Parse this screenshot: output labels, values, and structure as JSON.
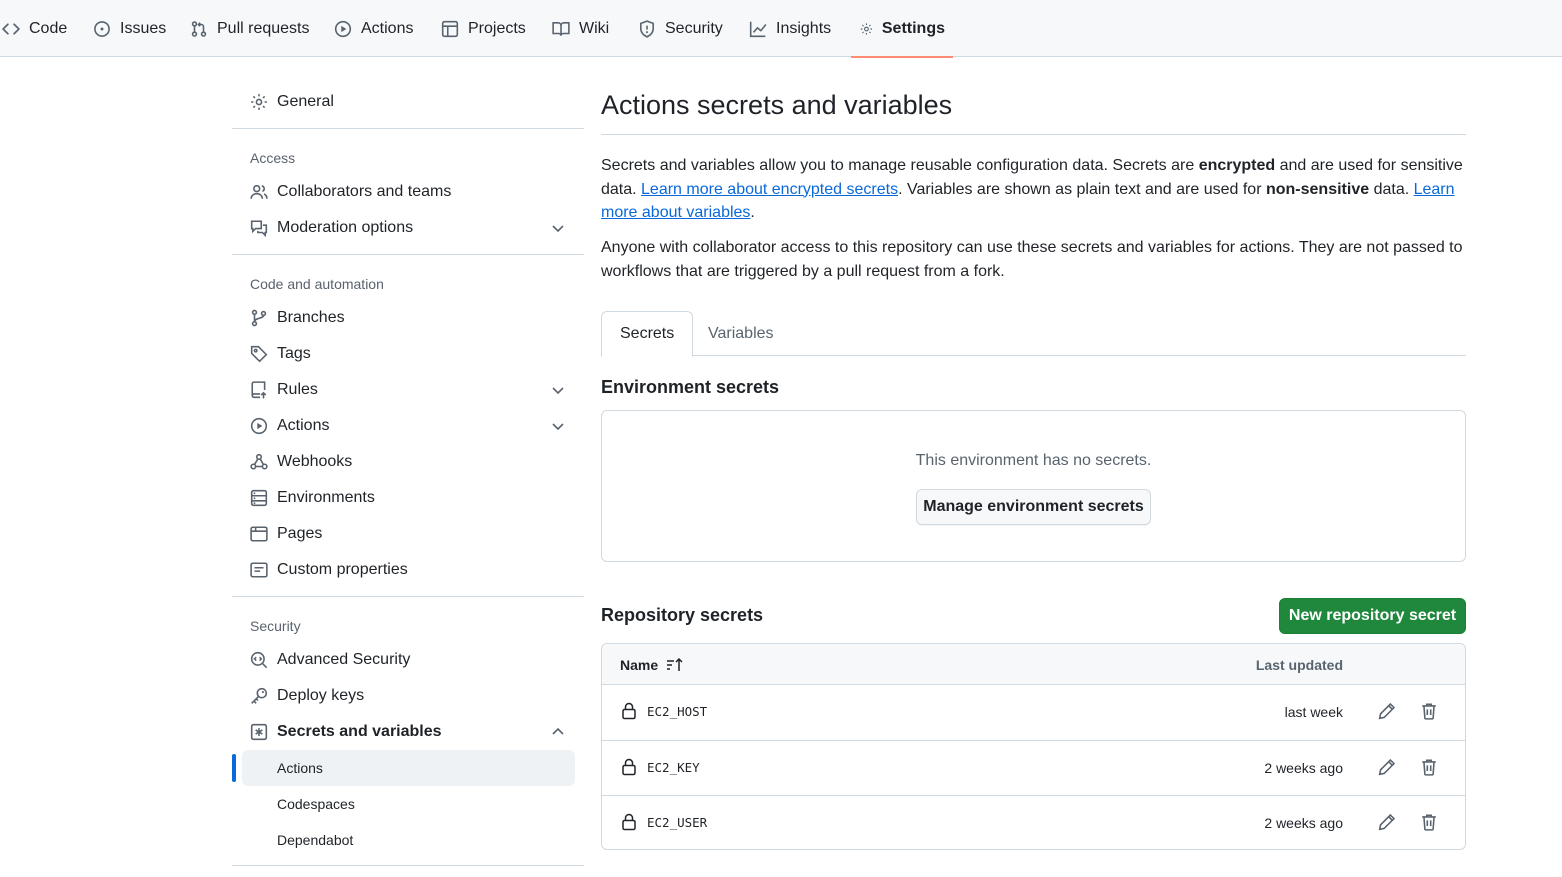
{
  "repo_nav": {
    "tabs": [
      {
        "label": "Code",
        "icon": "code-icon"
      },
      {
        "label": "Issues",
        "icon": "issue-icon"
      },
      {
        "label": "Pull requests",
        "icon": "pull-request-icon"
      },
      {
        "label": "Actions",
        "icon": "play-icon"
      },
      {
        "label": "Projects",
        "icon": "table-icon"
      },
      {
        "label": "Wiki",
        "icon": "book-icon"
      },
      {
        "label": "Security",
        "icon": "shield-icon"
      },
      {
        "label": "Insights",
        "icon": "graph-icon"
      },
      {
        "label": "Settings",
        "icon": "gear-icon",
        "active": true
      }
    ]
  },
  "sidebar": {
    "general": "General",
    "access_heading": "Access",
    "collaborators": "Collaborators and teams",
    "moderation": "Moderation options",
    "code_heading": "Code and automation",
    "branches": "Branches",
    "tags": "Tags",
    "rules": "Rules",
    "actions": "Actions",
    "webhooks": "Webhooks",
    "environments": "Environments",
    "pages": "Pages",
    "custom_properties": "Custom properties",
    "security_heading": "Security",
    "advanced_security": "Advanced Security",
    "deploy_keys": "Deploy keys",
    "secrets_variables": "Secrets and variables",
    "sub_actions": "Actions",
    "sub_codespaces": "Codespaces",
    "sub_dependabot": "Dependabot"
  },
  "main": {
    "title": "Actions secrets and variables",
    "intro": {
      "t1": "Secrets and variables allow you to manage reusable configuration data. Secrets are ",
      "b1": "encrypted",
      "t2": " and are used for sensitive data. ",
      "link1": "Learn more about encrypted secrets",
      "t3": ". Variables are shown as plain text and are used for ",
      "b2": "non-sensitive",
      "t4": " data. ",
      "link2": "Learn more about variables",
      "t5": "."
    },
    "notice": "Anyone with collaborator access to this repository can use these secrets and variables for actions. They are not passed to workflows that are triggered by a pull request from a fork.",
    "tabs": {
      "secrets": "Secrets",
      "variables": "Variables"
    },
    "env_heading": "Environment secrets",
    "env_empty": "This environment has no secrets.",
    "env_button": "Manage environment secrets",
    "repo_heading": "Repository secrets",
    "new_button": "New repository secret",
    "table": {
      "col_name": "Name",
      "col_updated": "Last updated",
      "rows": [
        {
          "name": "EC2_HOST",
          "updated": "last week"
        },
        {
          "name": "EC2_KEY",
          "updated": "2 weeks ago"
        },
        {
          "name": "EC2_USER",
          "updated": "2 weeks ago"
        }
      ]
    }
  },
  "colors": {
    "accent": "#0969da",
    "primary_button": "#1f883d",
    "tab_underline": "#fd8c73"
  }
}
